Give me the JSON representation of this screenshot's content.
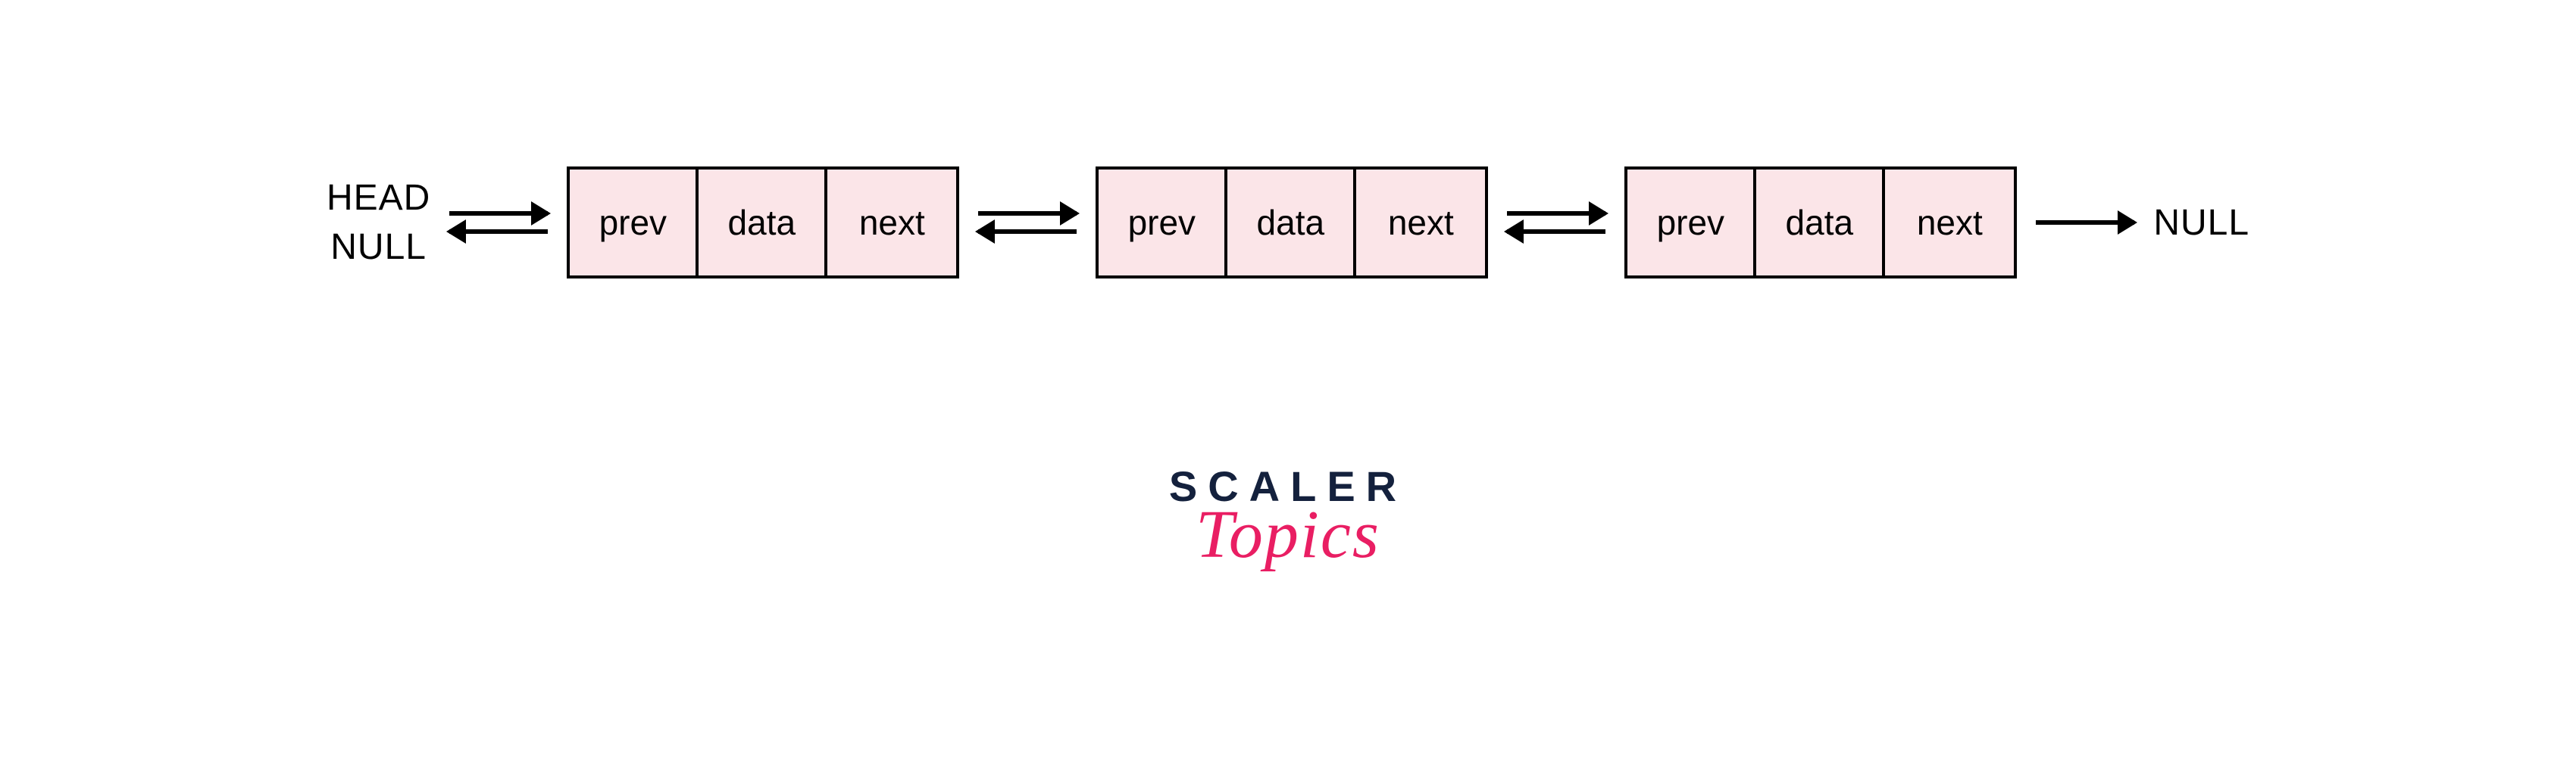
{
  "labels": {
    "head": "HEAD",
    "null_left": "NULL",
    "null_right": "NULL"
  },
  "nodes": [
    {
      "prev": "prev",
      "data": "data",
      "next": "next"
    },
    {
      "prev": "prev",
      "data": "data",
      "next": "next"
    },
    {
      "prev": "prev",
      "data": "data",
      "next": "next"
    }
  ],
  "logo": {
    "line1": "SCALER",
    "line2": "Topics"
  }
}
